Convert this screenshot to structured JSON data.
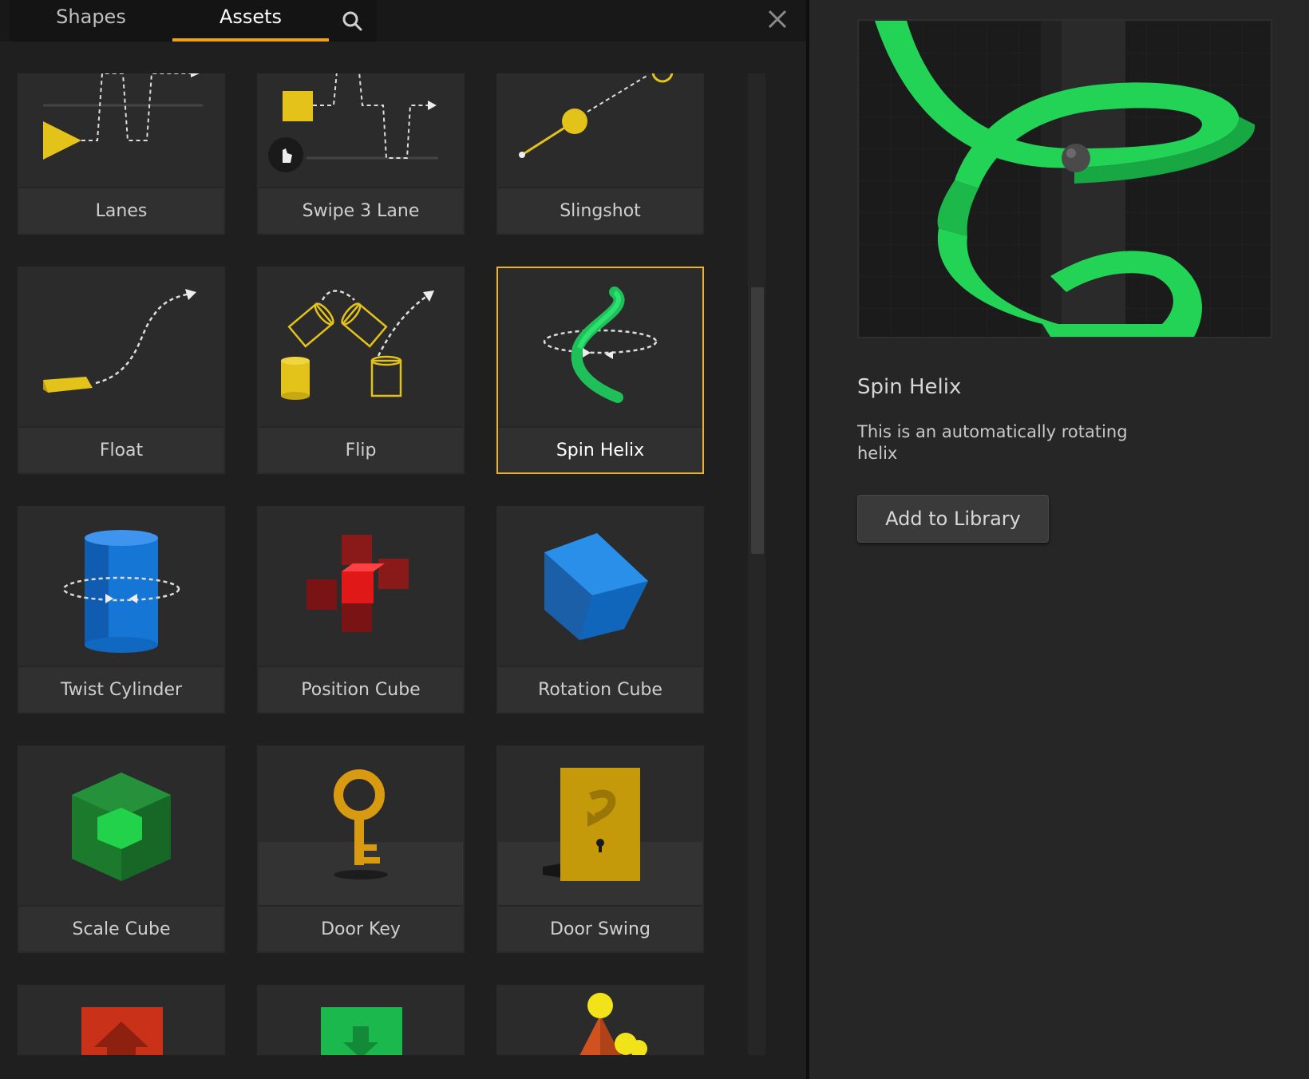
{
  "tabs": [
    {
      "label": "Shapes",
      "active": false
    },
    {
      "label": "Assets",
      "active": true
    }
  ],
  "toolbar": {
    "search_icon": "search-icon",
    "close_icon": "close-icon"
  },
  "colors": {
    "accent": "#f0a020",
    "selected_border": "#f0b030",
    "helix_green": "#22d355"
  },
  "assets": [
    {
      "label": "Lanes",
      "icon": "lanes-icon"
    },
    {
      "label": "Swipe 3 Lane",
      "icon": "swipe-3-lane-icon"
    },
    {
      "label": "Slingshot",
      "icon": "slingshot-icon"
    },
    {
      "label": "Float",
      "icon": "float-icon"
    },
    {
      "label": "Flip",
      "icon": "flip-icon"
    },
    {
      "label": "Spin Helix",
      "icon": "spin-helix-icon",
      "selected": true
    },
    {
      "label": "Twist Cylinder",
      "icon": "twist-cylinder-icon"
    },
    {
      "label": "Position Cube",
      "icon": "position-cube-icon"
    },
    {
      "label": "Rotation Cube",
      "icon": "rotation-cube-icon"
    },
    {
      "label": "Scale Cube",
      "icon": "scale-cube-icon"
    },
    {
      "label": "Door Key",
      "icon": "door-key-icon"
    },
    {
      "label": "Door Swing",
      "icon": "door-swing-icon"
    },
    {
      "icon": "up-arrow-block-icon"
    },
    {
      "icon": "down-arrow-block-icon"
    },
    {
      "icon": "pyramid-balls-icon"
    }
  ],
  "detail": {
    "title": "Spin Helix",
    "description": "This is an automatically rotating helix",
    "add_button_label": "Add to Library",
    "preview_icon": "spin-helix-preview"
  }
}
